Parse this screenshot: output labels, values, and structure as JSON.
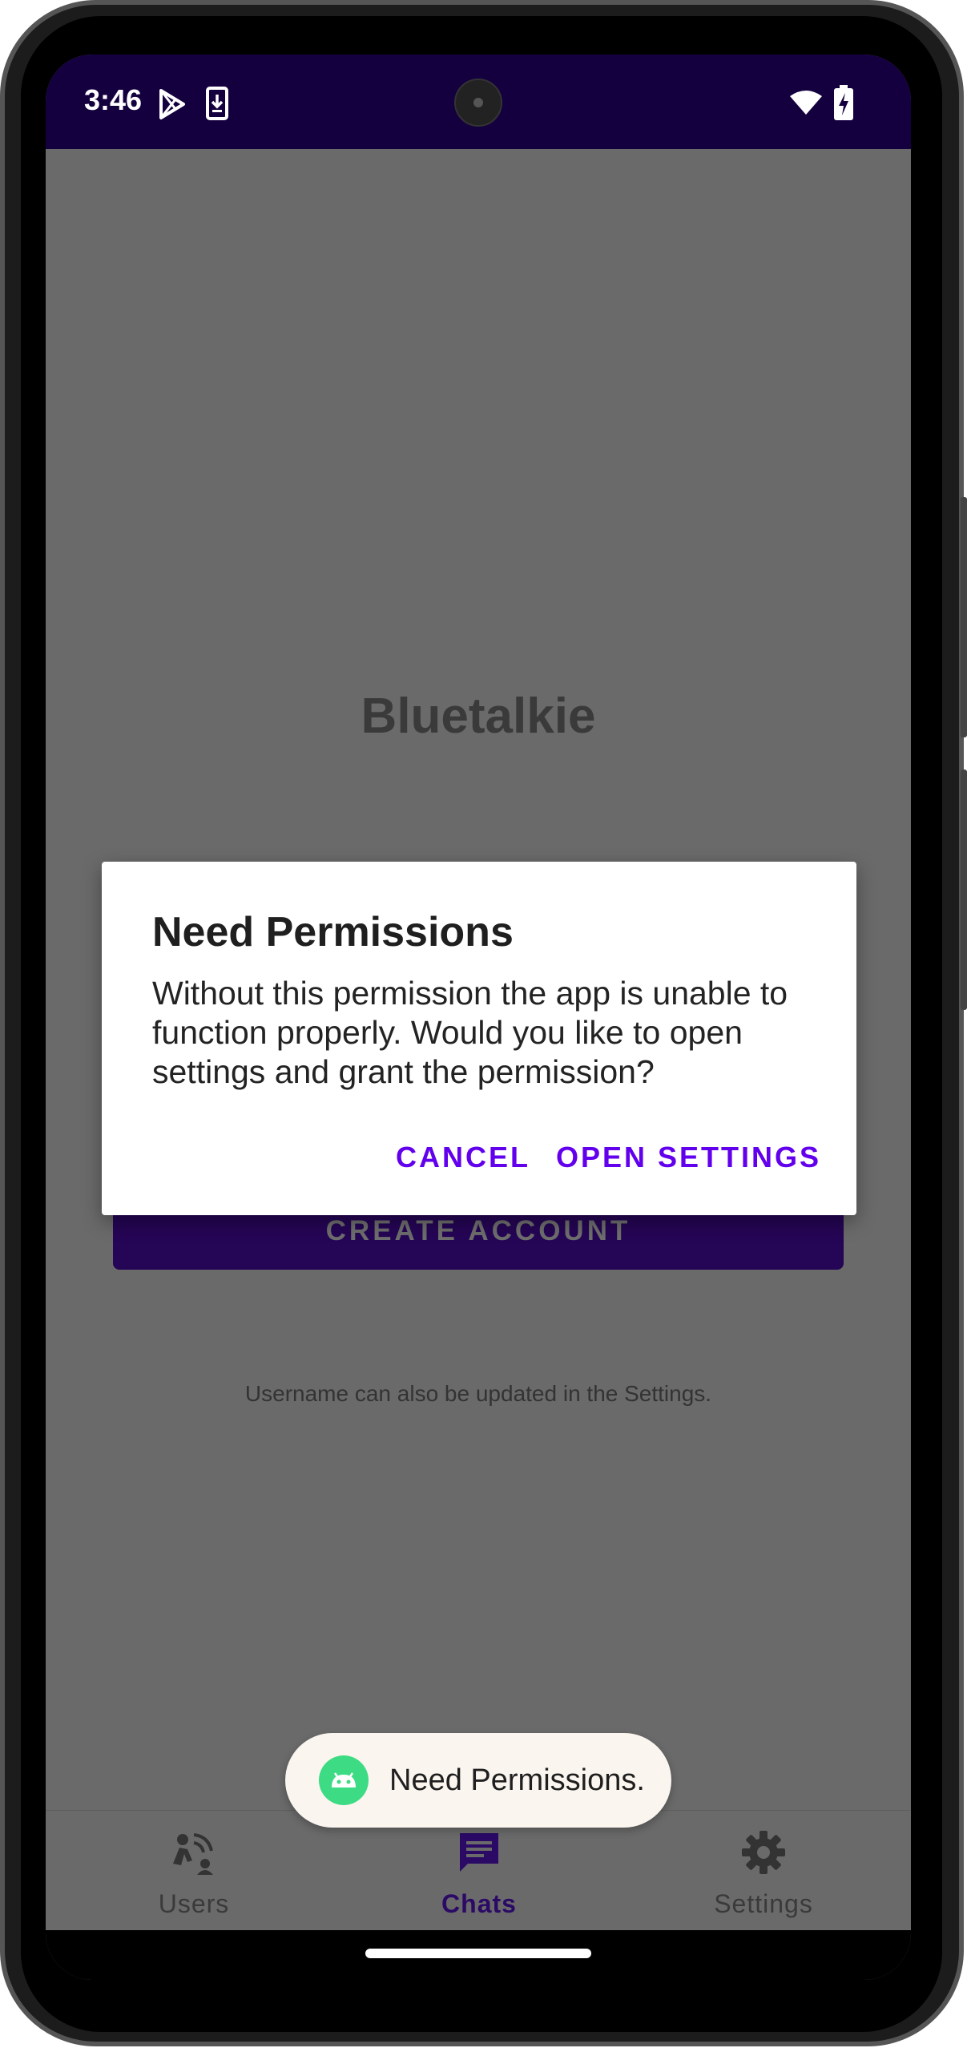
{
  "status_bar": {
    "time": "3:46",
    "icons": [
      "play-store-icon",
      "download-icon",
      "wifi-icon",
      "battery-charging-icon"
    ]
  },
  "app": {
    "title": "Bluetalkie",
    "create_account_label": "CREATE ACCOUNT",
    "hint": "Username can also be updated in the Settings."
  },
  "dialog": {
    "title": "Need Permissions",
    "message": "Without this permission the app is unable to function properly. Would you like to open settings and grant the permission?",
    "cancel_label": "CANCEL",
    "open_settings_label": "OPEN SETTINGS",
    "accent_color": "#6200ee"
  },
  "toast": {
    "text": "Need Permissions.",
    "icon": "android-icon"
  },
  "bottom_nav": {
    "items": [
      {
        "label": "Users",
        "icon": "users-nearby-icon",
        "selected": false
      },
      {
        "label": "Chats",
        "icon": "chat-icon",
        "selected": true
      },
      {
        "label": "Settings",
        "icon": "gear-icon",
        "selected": false
      }
    ]
  },
  "colors": {
    "status_bar": "#14003e",
    "primary_dark": "#250555",
    "scrim_background": "#6a6a6a"
  }
}
